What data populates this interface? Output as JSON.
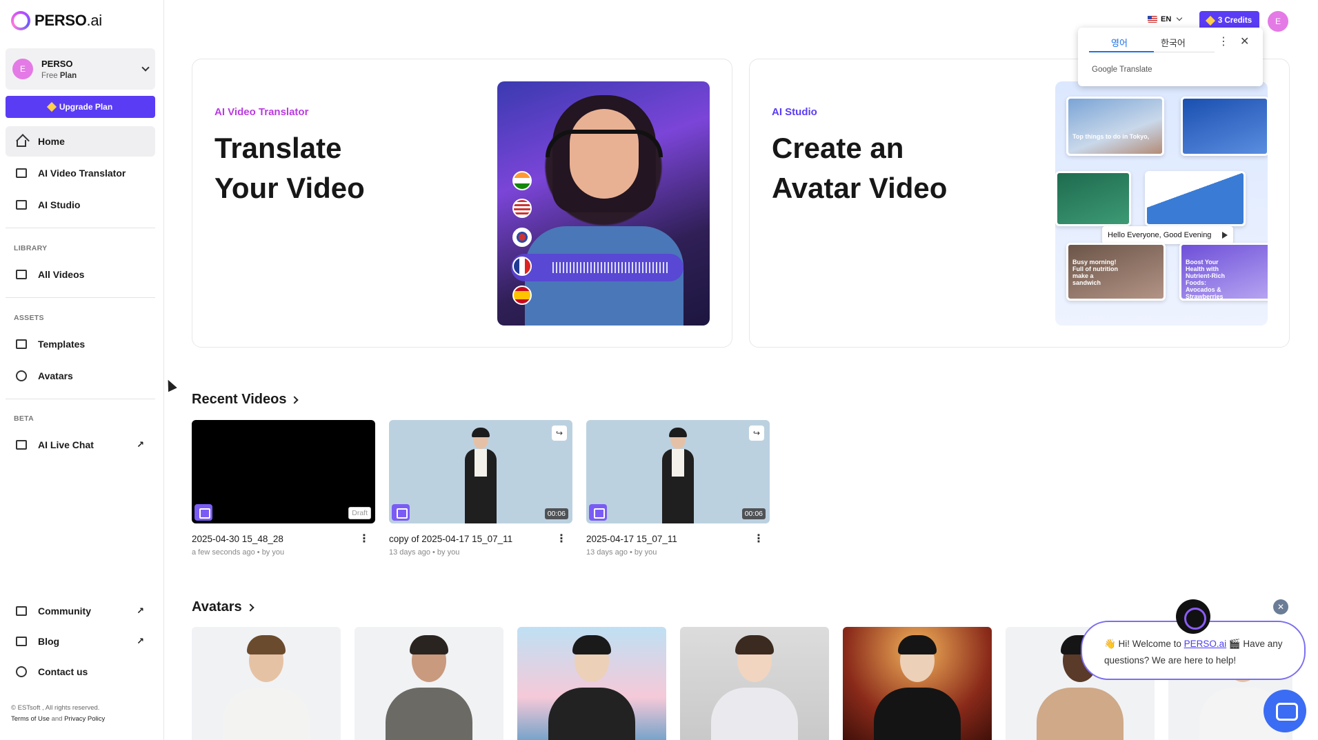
{
  "brand": {
    "name": "PERSO",
    "suffix": ".ai"
  },
  "workspace": {
    "initial": "E",
    "name": "PERSO",
    "plan_prefix": "Free",
    "plan": "Plan"
  },
  "upgrade_label": "Upgrade Plan",
  "nav": {
    "home": "Home",
    "video_translator": "AI Video Translator",
    "studio": "AI Studio",
    "library_label": "LIBRARY",
    "all_videos": "All Videos",
    "assets_label": "ASSETS",
    "templates": "Templates",
    "avatars": "Avatars",
    "beta_label": "BETA",
    "live_chat": "AI Live Chat",
    "community": "Community",
    "blog": "Blog",
    "contact": "Contact us",
    "ext_symbol": "↗"
  },
  "footer": {
    "copyright": "© ESTsoft , All rights reserved.",
    "terms": "Terms of Use",
    "and": "and",
    "privacy": "Privacy Policy"
  },
  "topbar": {
    "language": "EN",
    "credits": "3 Credits",
    "user_initial": "E"
  },
  "google_translate": {
    "tab_source": "영어",
    "tab_target": "한국어",
    "brand": "Google Translate",
    "more": "⋮",
    "close": "✕"
  },
  "hero_translator": {
    "kicker": "AI Video Translator",
    "kicker_color": "#b93be0",
    "title_line1": "Translate",
    "title_line2": "Your Video"
  },
  "hero_studio": {
    "kicker": "AI Studio",
    "kicker_color": "#5b3cf5",
    "title_line1": "Create an",
    "title_line2": "Avatar Video",
    "tile_caption_1": "Top things to do in Tokyo,",
    "tile_caption_2": "Busy morning! Full of nutrition make a sandwich",
    "tile_caption_3": "Boost Your Health with Nutrient-Rich Foods: Avocados & Strawberries",
    "pill": "Hello Everyone, Good Evening"
  },
  "recent": {
    "title": "Recent Videos",
    "videos": [
      {
        "title": "2025-04-30 15_48_28",
        "meta": "a few seconds ago • by you",
        "badge": "Draft"
      },
      {
        "title": "copy of 2025-04-17 15_07_11",
        "meta": "13 days ago • by you",
        "badge": "00:06"
      },
      {
        "title": "2025-04-17 15_07_11",
        "meta": "13 days ago • by you",
        "badge": "00:06"
      }
    ]
  },
  "avatars_section": {
    "title": "Avatars"
  },
  "chat": {
    "greeting_pre": "👋 Hi! Welcome to ",
    "link": "PERSO.ai",
    "greeting_post": " 🎬 Have any questions? We are here to help!",
    "close": "✕"
  }
}
